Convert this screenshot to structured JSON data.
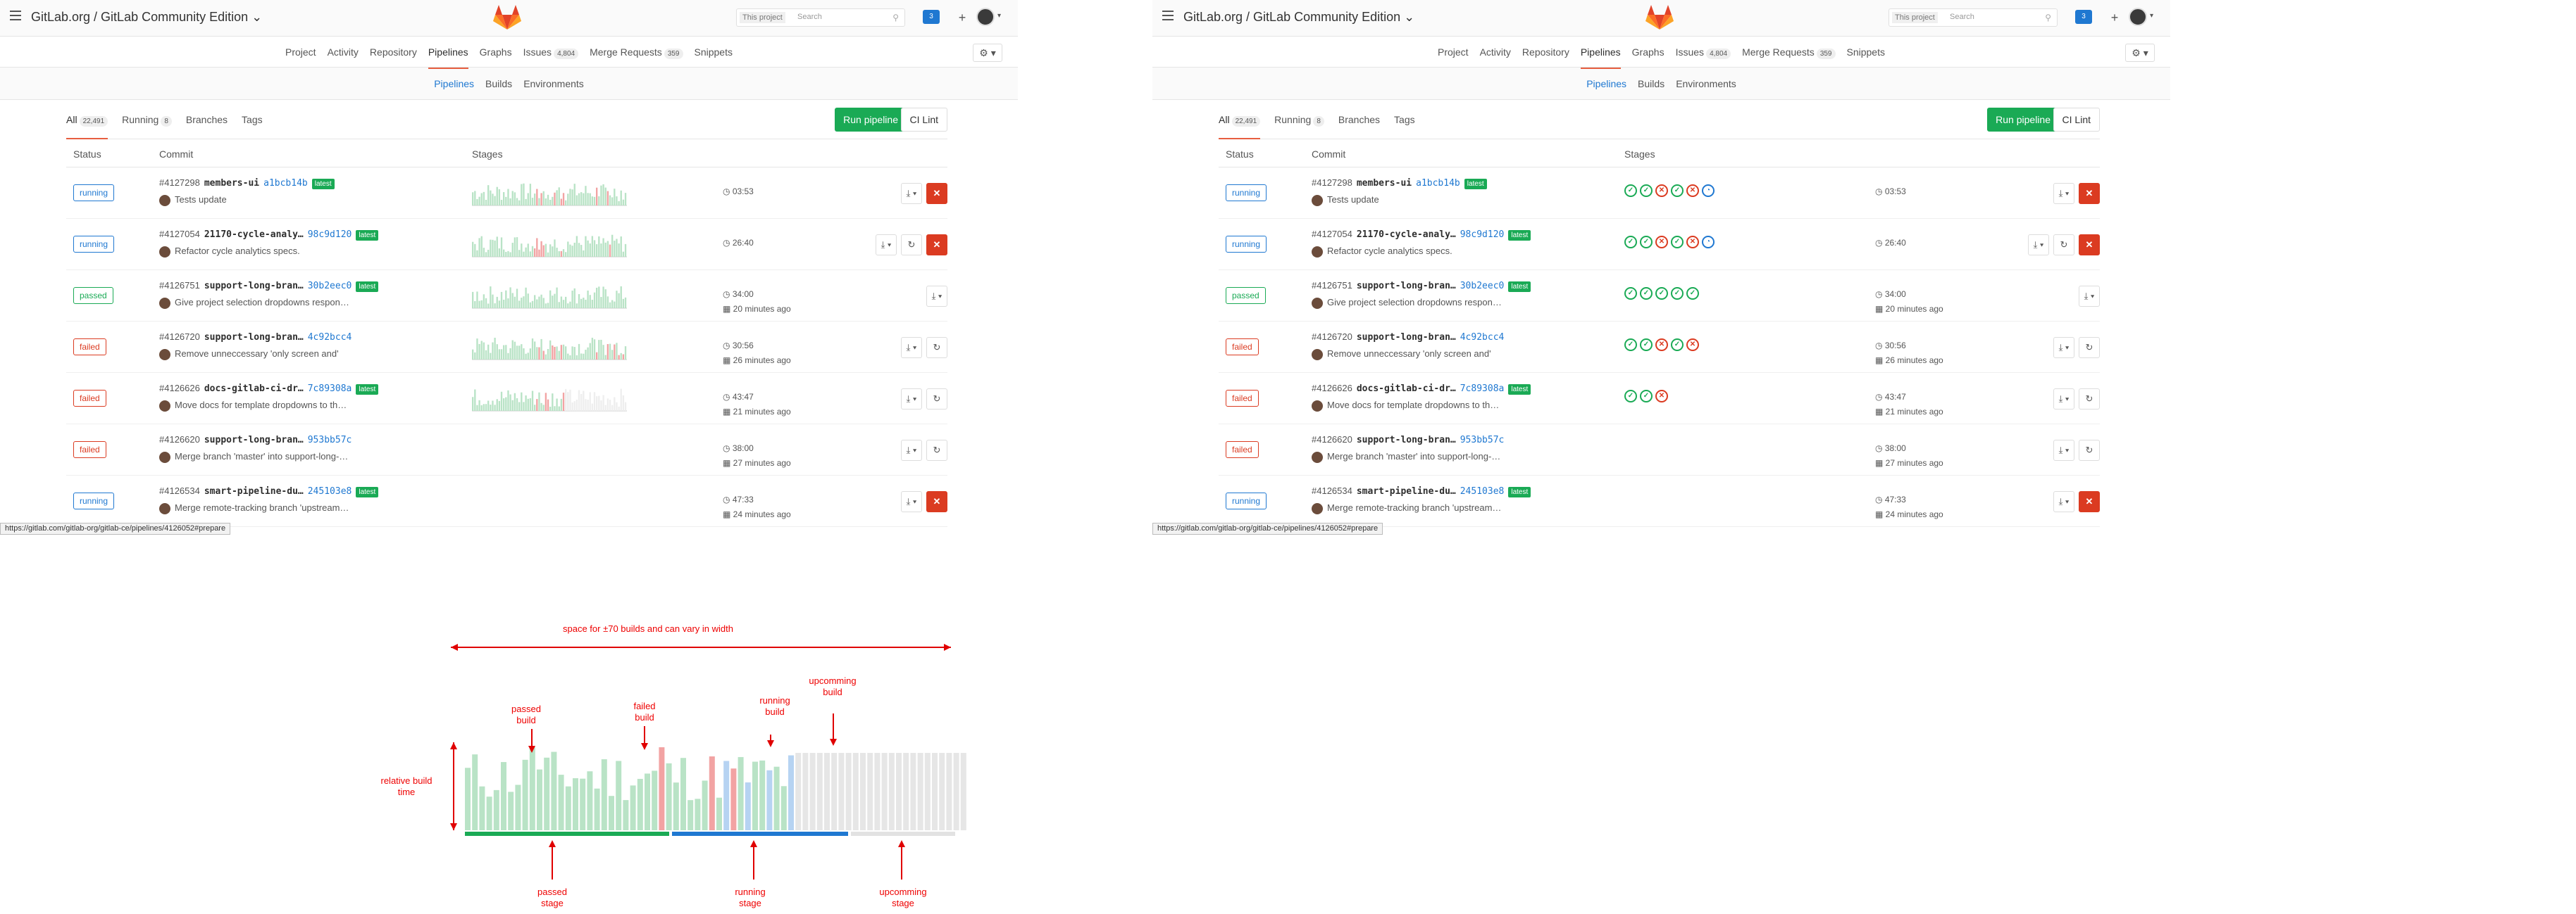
{
  "app": {
    "site_title": "GitLab.org / GitLab Community Edition",
    "search_scope": "This project",
    "search_placeholder": "Search",
    "todo_count": "3"
  },
  "project_nav": [
    {
      "label": "Project",
      "active": false
    },
    {
      "label": "Activity",
      "active": false
    },
    {
      "label": "Repository",
      "active": false
    },
    {
      "label": "Pipelines",
      "active": true
    },
    {
      "label": "Graphs",
      "active": false
    },
    {
      "label": "Issues",
      "badge": "4,804",
      "active": false
    },
    {
      "label": "Merge Requests",
      "badge": "359",
      "active": false
    },
    {
      "label": "Snippets",
      "active": false
    }
  ],
  "sub_nav": [
    {
      "label": "Pipelines",
      "active": true
    },
    {
      "label": "Builds",
      "active": false
    },
    {
      "label": "Environments",
      "active": false
    }
  ],
  "scopes": [
    {
      "label": "All",
      "badge": "22,491",
      "active": true
    },
    {
      "label": "Running",
      "badge": "8",
      "active": false
    },
    {
      "label": "Branches",
      "active": false
    },
    {
      "label": "Tags",
      "active": false
    }
  ],
  "buttons": {
    "run_pipeline": "Run pipeline",
    "ci_lint": "CI Lint"
  },
  "columns": {
    "status": "Status",
    "commit": "Commit",
    "stages": "Stages"
  },
  "pipelines": [
    {
      "status": "running",
      "id": "#4127298",
      "branch": "members-ui",
      "sha": "a1bcb14b",
      "latest": true,
      "message": "Tests update",
      "duration": "03:53",
      "finished": "",
      "stages": [
        "s",
        "s",
        "f",
        "s",
        "f",
        "r"
      ],
      "actions": [
        "download",
        "cancel"
      ]
    },
    {
      "status": "running",
      "id": "#4127054",
      "branch": "21170-cycle-analy…",
      "sha": "98c9d120",
      "latest": true,
      "message": "Refactor cycle analytics specs.",
      "duration": "26:40",
      "finished": "",
      "stages": [
        "s",
        "s",
        "f",
        "s",
        "f",
        "r"
      ],
      "actions": [
        "download",
        "retry",
        "cancel"
      ]
    },
    {
      "status": "passed",
      "id": "#4126751",
      "branch": "support-long-bran…",
      "sha": "30b2eec0",
      "latest": true,
      "message": "Give project selection dropdowns respon…",
      "duration": "34:00",
      "finished": "20 minutes ago",
      "stages": [
        "s",
        "s",
        "s",
        "s",
        "s"
      ],
      "actions": [
        "download"
      ]
    },
    {
      "status": "failed",
      "id": "#4126720",
      "branch": "support-long-bran…",
      "sha": "4c92bcc4",
      "latest": false,
      "message": "Remove unneccessary 'only screen and'",
      "duration": "30:56",
      "finished": "26 minutes ago",
      "stages": [
        "s",
        "s",
        "f",
        "s",
        "f"
      ],
      "actions": [
        "download",
        "retry"
      ]
    },
    {
      "status": "failed",
      "id": "#4126626",
      "branch": "docs-gitlab-ci-dr…",
      "sha": "7c89308a",
      "latest": true,
      "message": "Move docs for template dropdowns to th…",
      "duration": "43:47",
      "finished": "21 minutes ago",
      "stages": [
        "s",
        "s",
        "f"
      ],
      "actions": [
        "download",
        "retry"
      ]
    },
    {
      "status": "failed",
      "id": "#4126620",
      "branch": "support-long-bran…",
      "sha": "953bb57c",
      "latest": false,
      "message": "Merge branch 'master' into support-long-…",
      "duration": "38:00",
      "finished": "27 minutes ago",
      "stages": [],
      "actions": [
        "download",
        "retry"
      ]
    },
    {
      "status": "running",
      "id": "#4126534",
      "branch": "smart-pipeline-du…",
      "sha": "245103e8",
      "latest": true,
      "message": "Merge remote-tracking branch 'upstream…",
      "duration": "47:33",
      "finished": "24 minutes ago",
      "stages": [],
      "actions": [
        "download",
        "cancel"
      ]
    }
  ],
  "status_url": "https://gitlab.com/gitlab-org/gitlab-ce/pipelines/4126052#prepare",
  "diagram": {
    "top_label": "space for ±70 builds and can vary in width",
    "passed_build": "passed build",
    "failed_build": "failed build",
    "running_build": "running build",
    "upcoming_build": "upcomming build",
    "relative_build_time": "relative build time",
    "passed_stage": "passed stage",
    "running_stage": "running stage",
    "upcoming_stage": "upcomming stage"
  },
  "colors": {
    "passed": "#1aaa55",
    "failed": "#db3b21",
    "running": "#1f78d1",
    "pending": "#e2e2e2",
    "annotation": "#e00000"
  }
}
